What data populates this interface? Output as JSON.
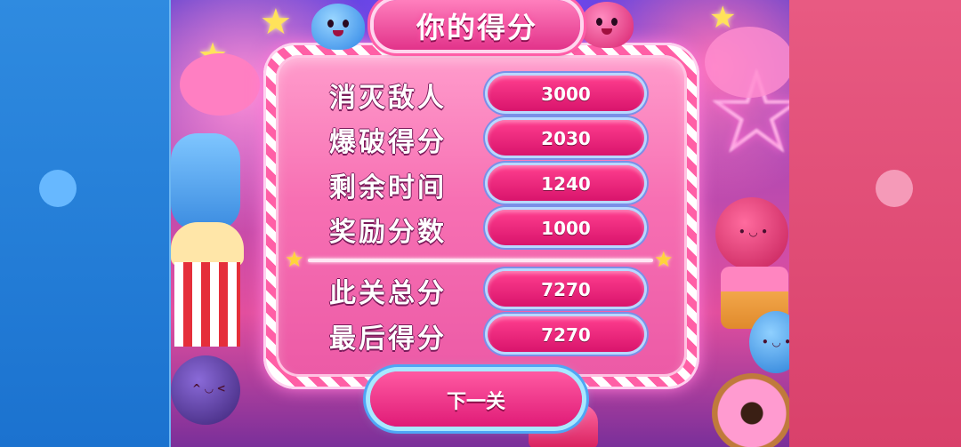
{
  "title": "你的得分",
  "score_rows": [
    {
      "label": "消灭敌人",
      "value": "3000"
    },
    {
      "label": "爆破得分",
      "value": "2030"
    },
    {
      "label": "剩余时间",
      "value": "1240"
    },
    {
      "label": "奖励分数",
      "value": "1000"
    }
  ],
  "total_rows": [
    {
      "label": "此关总分",
      "value": "7270"
    },
    {
      "label": "最后得分",
      "value": "7270"
    }
  ],
  "next_button": "下一关",
  "colors": {
    "left_bar": "#1b72cf",
    "right_bar": "#d9416b",
    "panel": "#f770b3",
    "pill": "#d9146c",
    "button_glow": "#4fa6f5"
  }
}
